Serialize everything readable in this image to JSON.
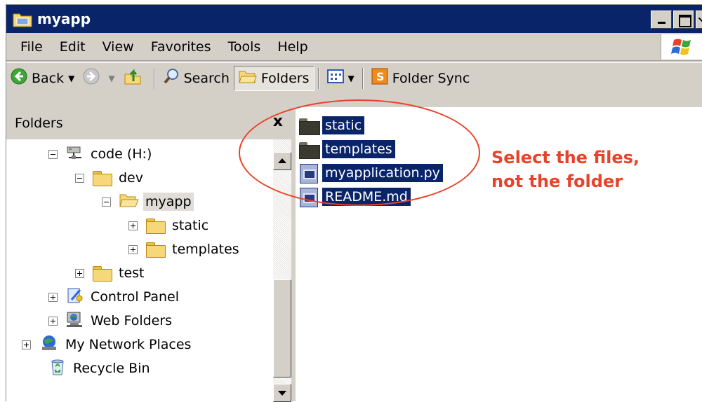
{
  "window": {
    "title": "myapp",
    "title_icon": "folder-icon"
  },
  "menu": [
    "File",
    "Edit",
    "View",
    "Favorites",
    "Tools",
    "Help"
  ],
  "toolbar": {
    "back_label": "Back",
    "search_label": "Search",
    "folders_label": "Folders",
    "folder_sync_label": "Folder Sync"
  },
  "folders_pane": {
    "header": "Folders",
    "close_glyph": "x",
    "tree": [
      {
        "label": "code (H:)",
        "icon": "network-drive-icon"
      },
      {
        "label": "dev",
        "icon": "folder-icon"
      },
      {
        "label": "myapp",
        "icon": "folder-open-icon"
      },
      {
        "label": "static",
        "icon": "folder-icon"
      },
      {
        "label": "templates",
        "icon": "folder-icon"
      },
      {
        "label": "test",
        "icon": "folder-icon"
      },
      {
        "label": "Control Panel",
        "icon": "control-panel-icon"
      },
      {
        "label": "Web Folders",
        "icon": "web-folders-icon"
      },
      {
        "label": "My Network Places",
        "icon": "network-places-icon"
      },
      {
        "label": "Recycle Bin",
        "icon": "recycle-bin-icon"
      }
    ]
  },
  "files": [
    {
      "name": "static",
      "icon": "folder-icon"
    },
    {
      "name": "templates",
      "icon": "folder-icon"
    },
    {
      "name": "myapplication.py",
      "icon": "file-icon"
    },
    {
      "name": "README.md",
      "icon": "file-icon"
    }
  ],
  "annotation": {
    "line1": "Select the files,",
    "line2": "not the folder",
    "color": "#e8432a"
  },
  "colors": {
    "titlebar": "#0a246a",
    "selection": "#0a246a",
    "chrome": "#d4d0c8"
  }
}
